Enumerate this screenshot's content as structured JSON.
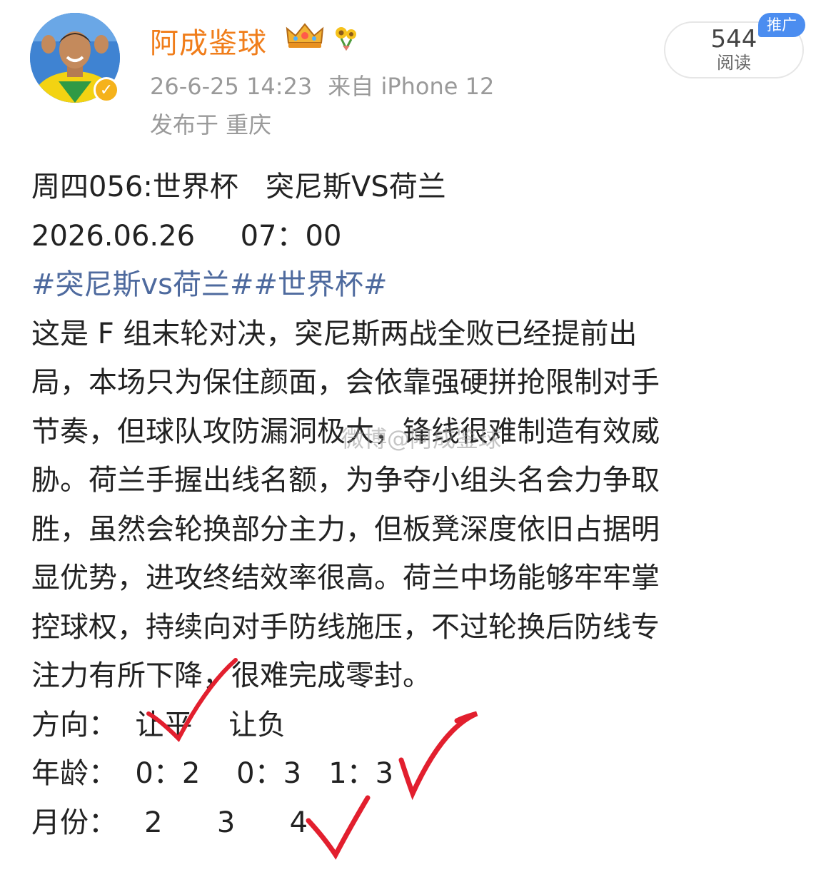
{
  "post": {
    "username": "阿成鉴球",
    "time": "26-6-25 14:23",
    "source": "来自 iPhone 12",
    "location": "发布于 重庆",
    "read_count": "544",
    "read_label": "阅读",
    "promo_badge": "推广"
  },
  "icons": {
    "crown": "crown-badge-icon",
    "flower": "sunflower-badge-icon",
    "verified": "verified-v-icon"
  },
  "colors": {
    "username": "#f07d1a",
    "topic": "#4e6a9e",
    "meta": "#9a9a9a",
    "promo": "#4b8df0",
    "checkmark": "#e21f2e"
  },
  "content": {
    "line1": "周四056:世界杯   突尼斯VS荷兰",
    "line2": "2026.06.26     07：00",
    "hashtags": "#突尼斯vs荷兰##世界杯#",
    "body": [
      "这是 F 组末轮对决，突尼斯两战全败已经提前出",
      "局，本场只为保住颜面，会依靠强硬拼抢限制对手",
      "节奏，但球队攻防漏洞极大，锋线很难制造有效威",
      "胁。荷兰手握出线名额，为争夺小组头名会力争取",
      "胜，虽然会轮换部分主力，但板凳深度依旧占据明",
      "显优势，进攻终结效率很高。荷兰中场能够牢牢掌",
      "控球权，持续向对手防线施压，不过轮换后防线专",
      "注力有所下降，很难完成零封。"
    ],
    "direction": "方向：  让平    让负",
    "age": "年龄：  0：2    0：3   1：3",
    "month": "月份：   2      3      4"
  },
  "watermark": "微博@阿成鉴球"
}
